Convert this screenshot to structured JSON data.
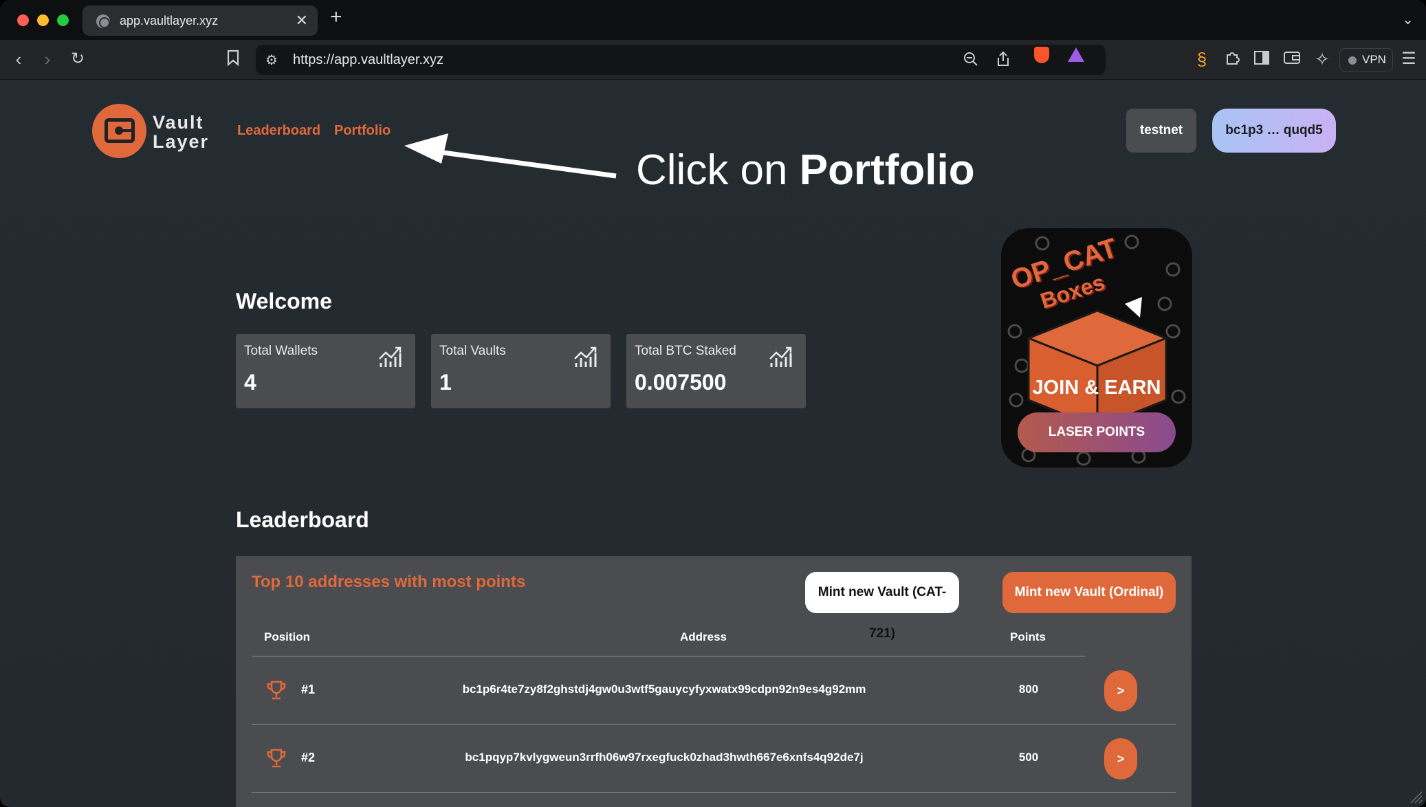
{
  "browser": {
    "tab_title": "app.vaultlayer.xyz",
    "tab_close": "✕",
    "new_tab": "+",
    "url": "https://app.vaultlayer.xyz",
    "vpn_label": "VPN"
  },
  "header": {
    "logo_line1": "Vault",
    "logo_line2": "Layer",
    "nav": [
      "Leaderboard",
      "Portfolio"
    ],
    "network": "testnet",
    "wallet": "bc1p3 … quqd5"
  },
  "annotation": {
    "prefix": "Click on ",
    "target": "Portfolio"
  },
  "welcome": {
    "heading": "Welcome",
    "stats": [
      {
        "label": "Total Wallets",
        "value": "4"
      },
      {
        "label": "Total Vaults",
        "value": "1"
      },
      {
        "label": "Total BTC Staked",
        "value": "0.007500"
      }
    ]
  },
  "promo": {
    "title": "OP_CAT",
    "subtitle": "Boxes",
    "headline": "JOIN & EARN",
    "button": "LASER POINTS"
  },
  "leaderboard": {
    "heading": "Leaderboard",
    "subtitle": "Top 10 addresses with most points",
    "mint_cat_label": "Mint new Vault (CAT-721)",
    "mint_ordinal_label": "Mint new Vault (Ordinal)",
    "columns": [
      "Position",
      "Address",
      "Points"
    ],
    "rows": [
      {
        "position": "#1",
        "address": "bc1p6r4te7zy8f2ghstdj4gw0u3wtf5gauycyfyxwatx99cdpn92n9es4g92mm",
        "points": "800",
        "action": ">"
      },
      {
        "position": "#2",
        "address": "bc1pqyp7kvlygweun3rrfh06w97rxegfuck0zhad3hwth667e6xnfs4q92de7j",
        "points": "500",
        "action": ">"
      }
    ]
  },
  "colors": {
    "accent": "#e0693b",
    "background": "#252c31",
    "card": "#4b4c4f"
  }
}
